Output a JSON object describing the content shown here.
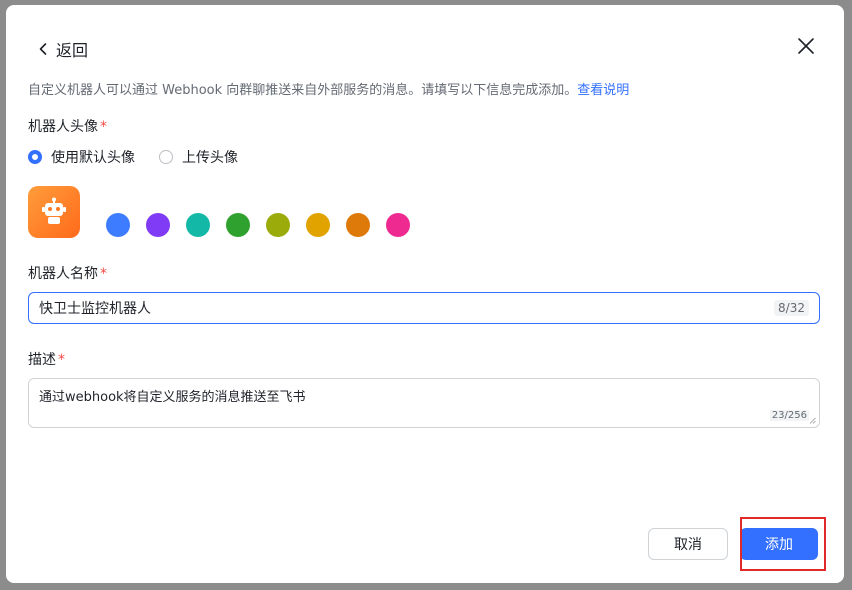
{
  "header": {
    "back_label": "返回"
  },
  "description": {
    "text": "自定义机器人可以通过 Webhook 向群聊推送来自外部服务的消息。请填写以下信息完成添加。",
    "link": "查看说明"
  },
  "avatar_section": {
    "label": "机器人头像",
    "required_mark": "*",
    "options": [
      "使用默认头像",
      "上传头像"
    ],
    "selected_index": 0,
    "avatar_color_from": "#ff9d3b",
    "avatar_color_to": "#ff6a1a",
    "swatches": [
      "#3d7bff",
      "#7f3bf5",
      "#14b8a6",
      "#2fa12f",
      "#9aab0a",
      "#e0a300",
      "#dd7a0a",
      "#ee2a90"
    ]
  },
  "name_section": {
    "label": "机器人名称",
    "required_mark": "*",
    "value": "快卫士监控机器人",
    "counter": "8/32"
  },
  "desc_section": {
    "label": "描述",
    "required_mark": "*",
    "value": "通过webhook将自定义服务的消息推送至飞书",
    "counter": "23/256"
  },
  "footer": {
    "cancel_label": "取消",
    "add_label": "添加"
  },
  "colors": {
    "primary": "#3370ff",
    "required": "#f54a45",
    "highlight": "#e02a2a"
  }
}
